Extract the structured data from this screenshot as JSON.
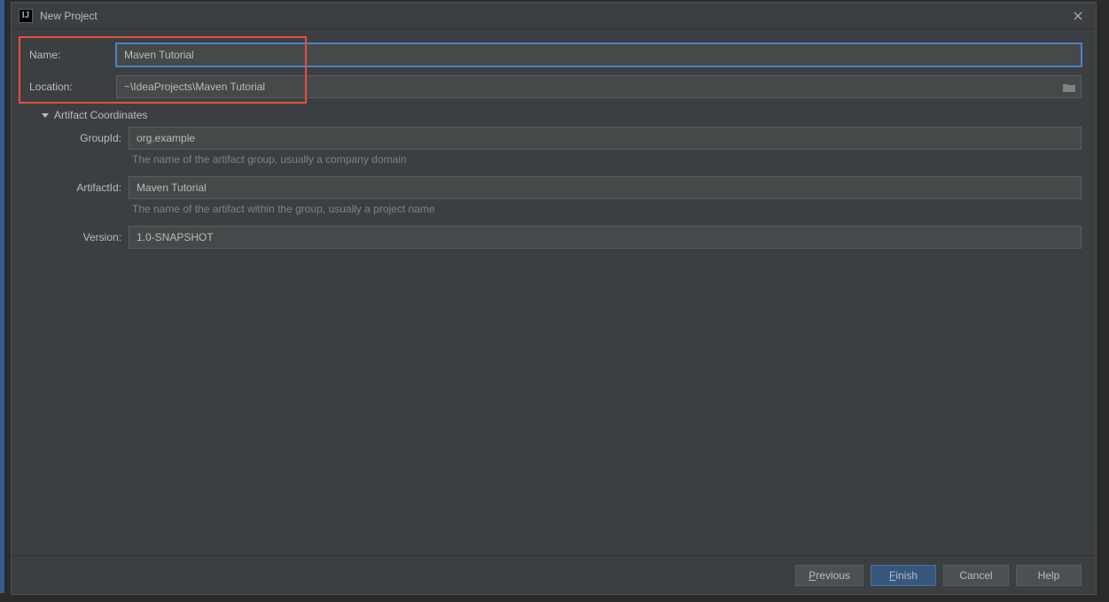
{
  "window": {
    "title": "New Project"
  },
  "form": {
    "name_label": "Name:",
    "name_value": "Maven Tutorial",
    "location_label": "Location:",
    "location_value": "~\\IdeaProjects\\Maven Tutorial"
  },
  "artifact": {
    "section_title": "Artifact Coordinates",
    "groupid_label": "GroupId:",
    "groupid_value": "org.example",
    "groupid_help": "The name of the artifact group, usually a company domain",
    "artifactid_label": "ArtifactId:",
    "artifactid_value": "Maven Tutorial",
    "artifactid_help": "The name of the artifact within the group, usually a project name",
    "version_label": "Version:",
    "version_value": "1.0-SNAPSHOT"
  },
  "buttons": {
    "previous": "Previous",
    "finish": "Finish",
    "cancel": "Cancel",
    "help": "Help"
  }
}
